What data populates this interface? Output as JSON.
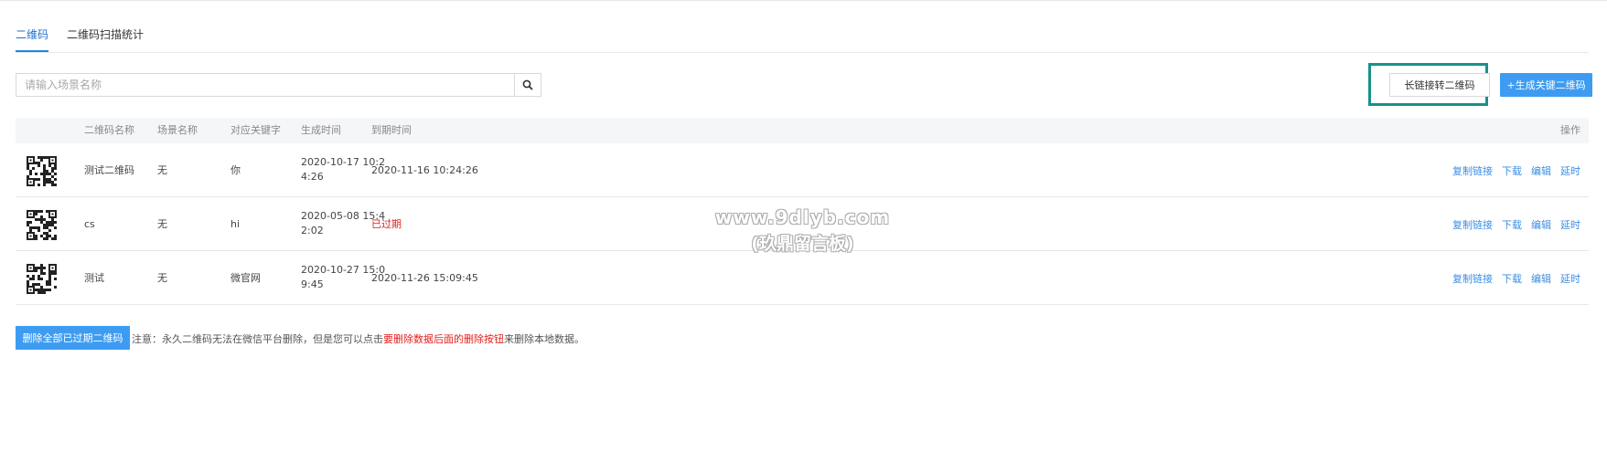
{
  "tabs": [
    {
      "label": "二维码",
      "active": true
    },
    {
      "label": "二维码扫描统计",
      "active": false
    }
  ],
  "search": {
    "placeholder": "请输入场景名称",
    "value": ""
  },
  "toolbar": {
    "longlink_label": "长链接转二维码",
    "create_label": "+生成关键二维码"
  },
  "table": {
    "headers": [
      "二维码名称",
      "场景名称",
      "对应关键字",
      "生成时间",
      "到期时间",
      "操作"
    ],
    "rows": [
      {
        "name": "测试二维码",
        "scene": "无",
        "keyword": "你",
        "created_1": "2020-10-17 10:2",
        "created_2": "4:26",
        "expire": "2020-11-16 10:24:26",
        "expired": false
      },
      {
        "name": "cs",
        "scene": "无",
        "keyword": "hi",
        "created_1": "2020-05-08 15:4",
        "created_2": "2:02",
        "expire": "已过期",
        "expired": true
      },
      {
        "name": "测试",
        "scene": "无",
        "keyword": "微官网",
        "created_1": "2020-10-27 15:0",
        "created_2": "9:45",
        "expire": "2020-11-26 15:09:45",
        "expired": false
      }
    ],
    "actions": [
      "复制链接",
      "下载",
      "编辑",
      "延时"
    ]
  },
  "footer": {
    "delete_label": "删除全部已过期二维码",
    "note_prefix": "注意：永久二维码无法在微信平台删除，但是您可以点击",
    "note_highlight": "要删除数据后面的删除按钮",
    "note_suffix": "来删除本地数据。"
  },
  "watermark": {
    "line1": "www.9dlyb.com",
    "line2": "(玖鼎留言板)"
  },
  "colors": {
    "accent": "#3d9cf2",
    "link": "#3a8ee6",
    "danger": "#e02020",
    "highlight_border": "#17928a"
  },
  "icons": {
    "search": "search-icon",
    "qr": "qr-code-icon"
  }
}
